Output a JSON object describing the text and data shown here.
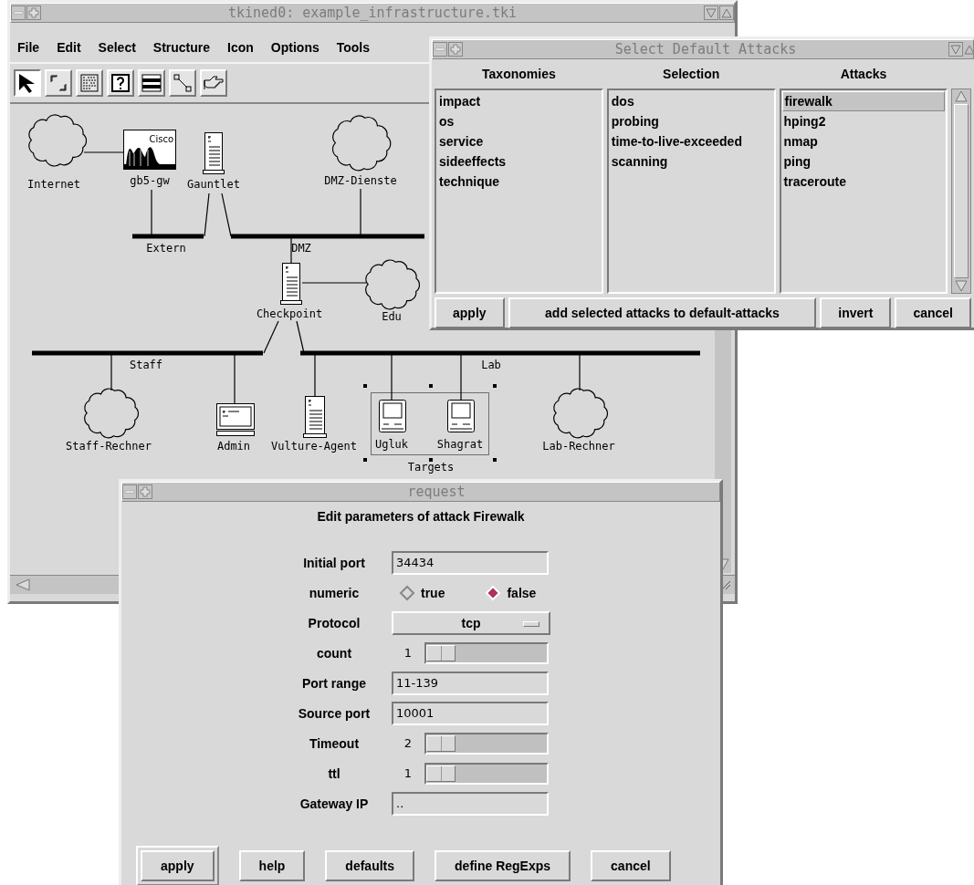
{
  "main_window": {
    "title": "tkined0: example_infrastructure.tki",
    "menu": [
      "File",
      "Edit",
      "Select",
      "Structure",
      "Icon",
      "Options",
      "Tools"
    ],
    "tools": [
      {
        "selected": true
      },
      {
        "selected": false
      },
      {
        "selected": false
      },
      {
        "selected": false
      },
      {
        "selected": false
      },
      {
        "selected": false
      },
      {
        "selected": false
      }
    ],
    "network": {
      "nodes": [
        {
          "kind": "cloud",
          "label": "Internet"
        },
        {
          "kind": "router",
          "label": "gb5-gw",
          "badge": "Cisco"
        },
        {
          "kind": "server",
          "label": "Gauntlet"
        },
        {
          "kind": "cloud",
          "label": "DMZ-Dienste"
        },
        {
          "kind": "server",
          "label": "Checkpoint"
        },
        {
          "kind": "cloud",
          "label": "Edu"
        },
        {
          "kind": "cloud",
          "label": "Staff-Rechner"
        },
        {
          "kind": "terminal",
          "label": "Admin"
        },
        {
          "kind": "server",
          "label": "Vulture-Agent"
        },
        {
          "kind": "mac",
          "label": "Ugluk"
        },
        {
          "kind": "mac",
          "label": "Shagrat"
        },
        {
          "kind": "cloud",
          "label": "Lab-Rechner"
        }
      ],
      "networks": [
        {
          "label": "Extern"
        },
        {
          "label": "DMZ"
        },
        {
          "label": "Staff"
        },
        {
          "label": "Lab"
        }
      ],
      "group": {
        "label": "Targets",
        "selected": true
      }
    }
  },
  "attacks_window": {
    "title": "Select Default Attacks",
    "columns": [
      {
        "heading": "Taxonomies",
        "items": [
          {
            "label": "impact",
            "selected": false
          },
          {
            "label": "os",
            "selected": false
          },
          {
            "label": "service",
            "selected": false
          },
          {
            "label": "sideeffects",
            "selected": false
          },
          {
            "label": "technique",
            "selected": false
          }
        ]
      },
      {
        "heading": "Selection",
        "items": [
          {
            "label": "dos",
            "selected": false
          },
          {
            "label": "probing",
            "selected": false
          },
          {
            "label": "time-to-live-exceeded",
            "selected": false
          },
          {
            "label": "scanning",
            "selected": false
          }
        ]
      },
      {
        "heading": "Attacks",
        "items": [
          {
            "label": "firewalk",
            "selected": true
          },
          {
            "label": "hping2",
            "selected": false
          },
          {
            "label": "nmap",
            "selected": false
          },
          {
            "label": "ping",
            "selected": false
          },
          {
            "label": "traceroute",
            "selected": false
          }
        ]
      }
    ],
    "buttons": [
      "apply",
      "add selected attacks to default-attacks",
      "invert",
      "cancel"
    ]
  },
  "request_dialog": {
    "title": "request",
    "heading": "Edit parameters of attack Firewalk",
    "fields": [
      {
        "kind": "entry",
        "label": "Initial port",
        "value": "34434"
      },
      {
        "kind": "radio",
        "label": "numeric",
        "options": [
          {
            "label": "true",
            "selected": false
          },
          {
            "label": "false",
            "selected": true
          }
        ]
      },
      {
        "kind": "menu",
        "label": "Protocol",
        "value": "tcp"
      },
      {
        "kind": "scale",
        "label": "count",
        "value": "1",
        "level": 0
      },
      {
        "kind": "entry",
        "label": "Port range",
        "value": "11-139"
      },
      {
        "kind": "entry",
        "label": "Source port",
        "value": "10001"
      },
      {
        "kind": "scale",
        "label": "Timeout",
        "value": "2",
        "level": 0
      },
      {
        "kind": "scale",
        "label": "ttl",
        "value": "1",
        "level": 0
      },
      {
        "kind": "entry",
        "label": "Gateway IP",
        "value": ".."
      }
    ],
    "buttons": [
      {
        "label": "apply",
        "default": true
      },
      {
        "label": "help",
        "default": false
      },
      {
        "label": "defaults",
        "default": false
      },
      {
        "label": "define RegExps",
        "default": false
      },
      {
        "label": "cancel",
        "default": false
      }
    ]
  }
}
